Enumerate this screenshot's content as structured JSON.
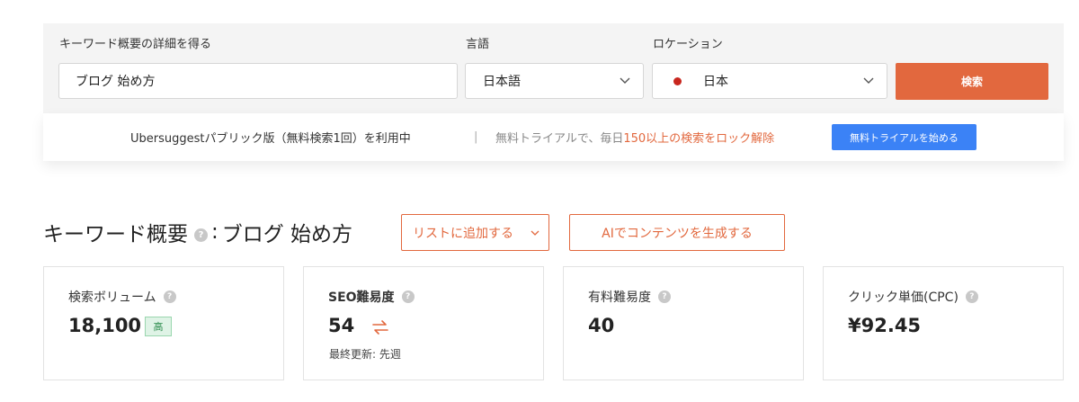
{
  "search": {
    "keyword_label": "キーワード概要の詳細を得る",
    "keyword_value": "ブログ 始め方",
    "language_label": "言語",
    "language_value": "日本語",
    "location_label": "ロケーション",
    "location_value": "日本",
    "search_button": "検索"
  },
  "promo": {
    "main_text": "Ubersuggestパブリック版（無料検索1回）を利用中",
    "separator": "|",
    "sub_text_before": "無料トライアルで、毎日",
    "sub_text_accent": "150以上の検索をロック解除",
    "trial_button": "無料トライアルを始める"
  },
  "overview": {
    "title": "キーワード概要",
    "colon": ":",
    "keyword": "ブログ 始め方",
    "add_to_list_button": "リストに追加する",
    "ai_content_button": "AIでコンテンツを生成する"
  },
  "metrics": [
    {
      "label": "検索ボリューム",
      "value": "18,100",
      "badge": "高"
    },
    {
      "label": "SEO難易度",
      "value": "54",
      "sub": "最終更新: 先週"
    },
    {
      "label": "有料難易度",
      "value": "40"
    },
    {
      "label": "クリック単価(CPC)",
      "value": "¥92.45"
    }
  ],
  "icons": {
    "help": "?",
    "flag_dot_color": "#c8261e"
  },
  "colors": {
    "accent": "#e2683e",
    "primary_blue": "#3b82f6",
    "badge_green": "#2a8b4c"
  }
}
